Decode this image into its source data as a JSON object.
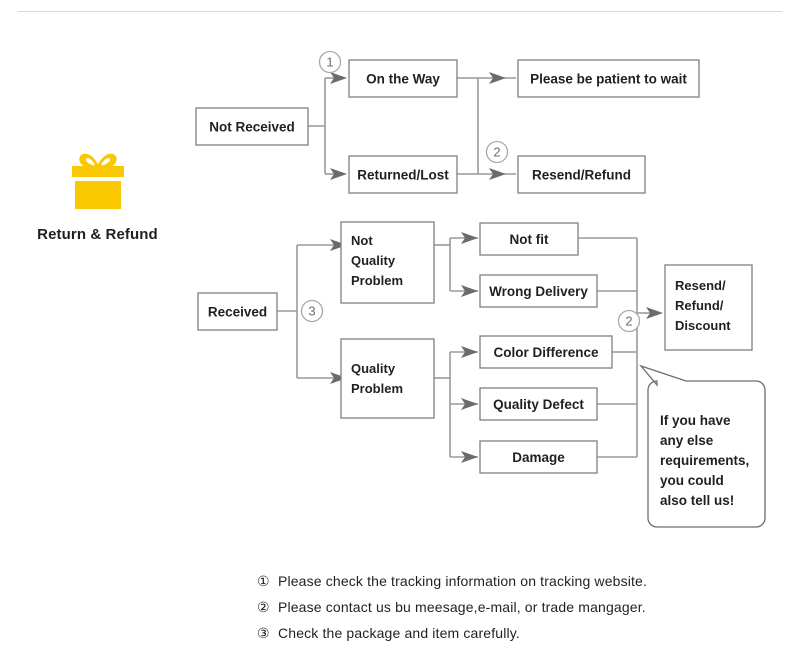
{
  "brand": {
    "icon": "gift-box-icon",
    "label": "Return & Refund",
    "icon_color": "#FAC800"
  },
  "theme": {
    "box_border": "#808080",
    "connector": "#9a9a9a",
    "arrow": "#6b6b6b",
    "marker": "#a8a8a8",
    "text": "#231f20",
    "divider": "#d8d8d8"
  },
  "flow": {
    "nodes": {
      "not_received": "Not Received",
      "on_the_way": "On the Way",
      "returned_lost": "Returned/Lost",
      "please_wait": "Please be patient to wait",
      "resend_refund": "Resend/Refund",
      "received": "Received",
      "not_quality_problem_l1": "Not",
      "not_quality_problem_l2": "Quality",
      "not_quality_problem_l3": "Problem",
      "quality_problem_l1": "Quality",
      "quality_problem_l2": "Problem",
      "not_fit": "Not fit",
      "wrong_delivery": "Wrong Delivery",
      "color_difference": "Color Difference",
      "quality_defect": "Quality Defect",
      "damage": "Damage",
      "resend_refund_discount_l1": "Resend/",
      "resend_refund_discount_l2": "Refund/",
      "resend_refund_discount_l3": "Discount"
    },
    "markers": {
      "one_top": "1",
      "two_top": "2",
      "three_bottom": "3",
      "two_bottom": "2"
    },
    "bubble": {
      "line1": "If you have",
      "line2": "any else",
      "line3": "requirements,",
      "line4": "you could",
      "line5": "also tell us!"
    }
  },
  "notes": [
    {
      "num": "①",
      "text": "Please check the tracking information on tracking website."
    },
    {
      "num": "②",
      "text": "Please contact us bu meesage,e-mail, or trade mangager."
    },
    {
      "num": "③",
      "text": "Check the package and item carefully."
    }
  ]
}
